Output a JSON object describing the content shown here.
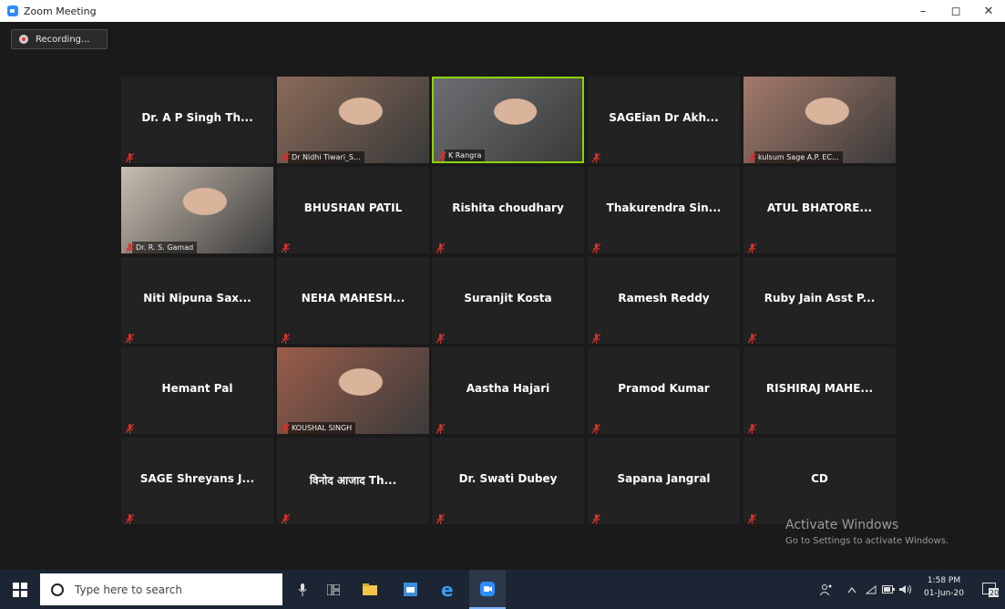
{
  "window": {
    "title": "Zoom Meeting",
    "minimize": "–",
    "maximize": "◻",
    "close": "✕"
  },
  "recording": {
    "label": "Recording..."
  },
  "tiles": [
    {
      "name": "Dr. A P Singh Th...",
      "video": false
    },
    {
      "name": "Dr Nidhi Tiwari_S...",
      "video": true,
      "bg": "#8a6a58"
    },
    {
      "name": "K Rangra",
      "video": true,
      "bg": "#6c6f72",
      "active": true
    },
    {
      "name": "SAGEian Dr Akh...",
      "video": false
    },
    {
      "name": "kulsum Sage A.P. EC...",
      "video": true,
      "bg": "#a47a6a"
    },
    {
      "name": "Dr. R. S. Gamad",
      "video": true,
      "bg": "#c9bdb0"
    },
    {
      "name": "BHUSHAN PATIL",
      "video": false
    },
    {
      "name": "Rishita choudhary",
      "video": false
    },
    {
      "name": "Thakurendra  Sin...",
      "video": false
    },
    {
      "name": "ATUL BHATORE...",
      "video": false
    },
    {
      "name": "Niti Nipuna Sax...",
      "video": false
    },
    {
      "name": "NEHA  MAHESH...",
      "video": false
    },
    {
      "name": "Suranjit Kosta",
      "video": false
    },
    {
      "name": "Ramesh Reddy",
      "video": false
    },
    {
      "name": "Ruby Jain Asst P...",
      "video": false
    },
    {
      "name": "Hemant Pal",
      "video": false
    },
    {
      "name": "KOUSHAL SINGH",
      "video": true,
      "bg": "#9a5d4a"
    },
    {
      "name": "Aastha Hajari",
      "video": false
    },
    {
      "name": "Pramod Kumar",
      "video": false
    },
    {
      "name": "RISHIRAJ  MAHE...",
      "video": false
    },
    {
      "name": "SAGE Shreyans J...",
      "video": false
    },
    {
      "name": "विनोद आजाद Th...",
      "video": false
    },
    {
      "name": "Dr. Swati Dubey",
      "video": false
    },
    {
      "name": "Sapana Jangral",
      "video": false
    },
    {
      "name": "CD",
      "video": false
    }
  ],
  "watermark": {
    "line1": "Activate Windows",
    "line2": "Go to Settings to activate Windows."
  },
  "taskbar": {
    "search_placeholder": "Type here to search",
    "time": "1:58 PM",
    "date": "01-Jun-20",
    "notification_count": "20"
  },
  "colors": {
    "muted_mic": "#d9302a",
    "active_speaker": "#8fd400",
    "taskbar": "#1c2533"
  }
}
